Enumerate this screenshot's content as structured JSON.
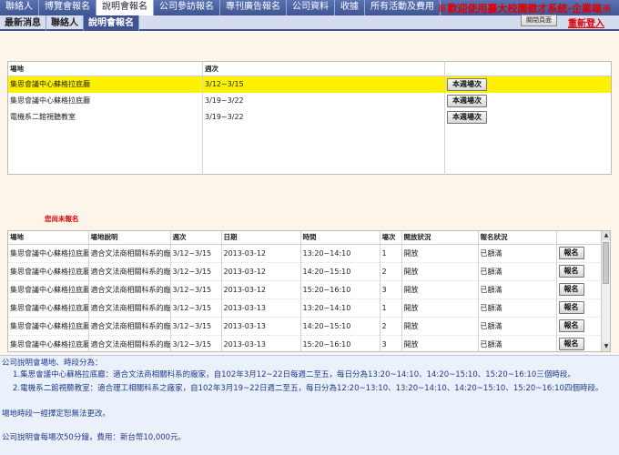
{
  "top_nav": {
    "items": [
      "聯絡人",
      "博覽會報名",
      "說明會報名",
      "公司參訪報名",
      "專刊廣告報名",
      "公司資料",
      "收據",
      "所有活動及費用"
    ],
    "active_index": 2
  },
  "welcome_text": "※歡迎使用臺大校園徵才系統-企業端※",
  "close_label": "關閉頁面",
  "relogin_label": "重新登入",
  "sub_nav": {
    "items": [
      "最新消息",
      "聯絡人",
      "說明會報名"
    ],
    "active_index": 2
  },
  "venue_table": {
    "headers": [
      "場地",
      "週次",
      ""
    ],
    "rows": [
      {
        "venue": "集思會議中心蘇格拉底廳",
        "week": "3/12~3/15",
        "button": "本週場次",
        "selected": true
      },
      {
        "venue": "集思會議中心蘇格拉底廳",
        "week": "3/19~3/22",
        "button": "本週場次",
        "selected": false
      },
      {
        "venue": "電機系二館視聽教室",
        "week": "3/19~3/22",
        "button": "本週場次",
        "selected": false
      }
    ]
  },
  "section_title": "您尚未報名",
  "session_table": {
    "headers": [
      "場地",
      "場地說明",
      "週次",
      "日期",
      "時間",
      "場次",
      "開放狀況",
      "報名狀況",
      ""
    ],
    "rows": [
      {
        "venue": "集思會議中心蘇格拉底廳",
        "desc": "適合文法商相關科系的廠家",
        "week": "3/12~3/15",
        "date": "2013-03-12",
        "time": "13:20~14:10",
        "no": "1",
        "open": "開放",
        "status": "已額滿",
        "button": "報名"
      },
      {
        "venue": "集思會議中心蘇格拉底廳",
        "desc": "適合文法商相關科系的廠家",
        "week": "3/12~3/15",
        "date": "2013-03-12",
        "time": "14:20~15:10",
        "no": "2",
        "open": "開放",
        "status": "已額滿",
        "button": "報名"
      },
      {
        "venue": "集思會議中心蘇格拉底廳",
        "desc": "適合文法商相關科系的廠家",
        "week": "3/12~3/15",
        "date": "2013-03-12",
        "time": "15:20~16:10",
        "no": "3",
        "open": "開放",
        "status": "已額滿",
        "button": "報名"
      },
      {
        "venue": "集思會議中心蘇格拉底廳",
        "desc": "適合文法商相關科系的廠家",
        "week": "3/12~3/15",
        "date": "2013-03-13",
        "time": "13:20~14:10",
        "no": "1",
        "open": "開放",
        "status": "已額滿",
        "button": "報名"
      },
      {
        "venue": "集思會議中心蘇格拉底廳",
        "desc": "適合文法商相關科系的廠家",
        "week": "3/12~3/15",
        "date": "2013-03-13",
        "time": "14:20~15:10",
        "no": "2",
        "open": "開放",
        "status": "已額滿",
        "button": "報名"
      },
      {
        "venue": "集思會議中心蘇格拉底廳",
        "desc": "適合文法商相關科系的廠家",
        "week": "3/12~3/15",
        "date": "2013-03-13",
        "time": "15:20~16:10",
        "no": "3",
        "open": "開放",
        "status": "已額滿",
        "button": "報名"
      }
    ]
  },
  "info": {
    "heading": "公司說明會場地、時段分為：",
    "line1": "1.集思會議中心蘇格拉底廳：適合文法商相關科系的廠家，自102年3月12~22日每週二至五，每日分為13:20~14:10、14:20~15:10、15:20~16:10三個時段。",
    "line2": "2.電機系二館視聽教室：適合理工相關科系之廠家，自102年3月19~22日週二至五，每日分為12:20~13:10、13:20~14:10、14:20~15:10、15:20~16:10四個時段。",
    "note": "場地時段一經擇定恕無法更改。",
    "fee": "公司說明會每場次50分鐘，費用：新台幣10,000元。"
  },
  "colors": {
    "nav_blue": "#3f5593",
    "highlight": "#fff200",
    "alert_red": "#e00000",
    "info_bg": "#eaf1fb"
  }
}
